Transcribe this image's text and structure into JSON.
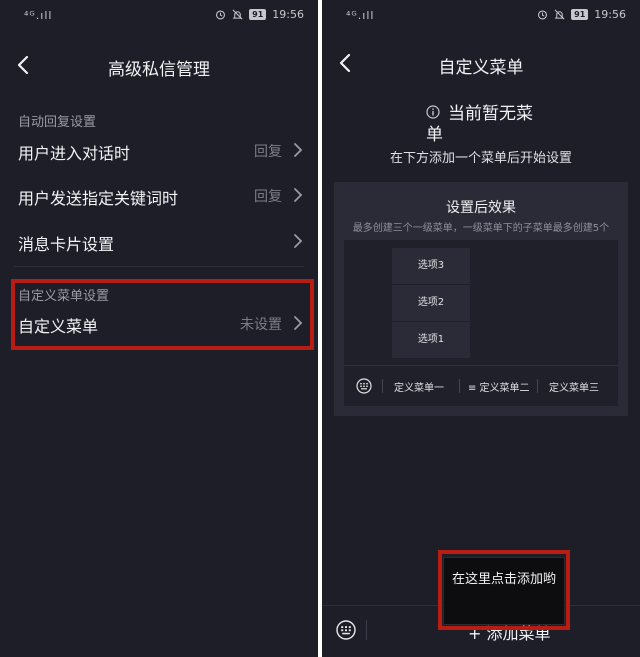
{
  "status": {
    "signal": "⁴ᴳ.ıll",
    "battery": "91",
    "time": "19:56"
  },
  "left": {
    "title": "高级私信管理",
    "section_auto": "自动回复设置",
    "rows": [
      {
        "label": "用户进入对话时",
        "value": "回复"
      },
      {
        "label": "用户发送指定关键词时",
        "value": "回复"
      },
      {
        "label": "消息卡片设置",
        "value": ""
      }
    ],
    "section_menu": "自定义菜单设置",
    "custom_menu": {
      "label": "自定义菜单",
      "value": "未设置"
    }
  },
  "right": {
    "title": "自定义菜单",
    "empty_line1": "当前暂无菜",
    "empty_line2": "单",
    "empty_hint": "在下方添加一个菜单后开始设置",
    "preview": {
      "title": "设置后效果",
      "subtitle": "最多创建三个一级菜单，一级菜单下的子菜单最多创建5个",
      "sub_items": [
        "选项3",
        "选项2",
        "选项1"
      ],
      "menu_items": [
        "定义菜单一",
        "≡ 定义菜单二",
        "定义菜单三"
      ]
    },
    "add_menu": "+ 添加菜单",
    "tooltip": "在这里点击添加哟"
  },
  "colors": {
    "background": "#1d1e28",
    "highlight": "#b81d14"
  }
}
